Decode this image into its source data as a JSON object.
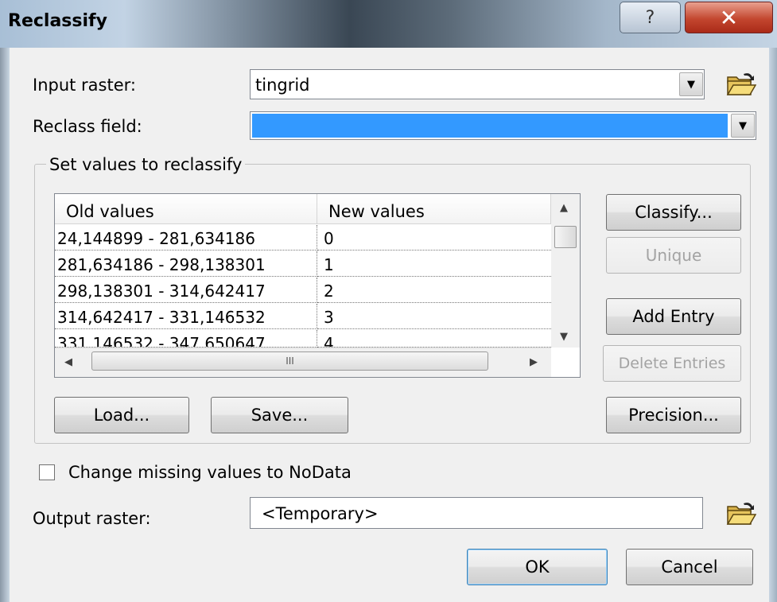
{
  "window": {
    "title": "Reclassify",
    "help_glyph": "?",
    "close_glyph": "✕"
  },
  "input_raster": {
    "label": "Input raster:",
    "value": "tingrid"
  },
  "reclass_field": {
    "label": "Reclass field:",
    "value": ""
  },
  "group": {
    "title": "Set values to reclassify",
    "columns": [
      "Old values",
      "New values"
    ],
    "rows": [
      {
        "old": "24,144899 - 281,634186",
        "new": "0"
      },
      {
        "old": "281,634186 - 298,138301",
        "new": "1"
      },
      {
        "old": "298,138301 - 314,642417",
        "new": "2"
      },
      {
        "old": "314,642417 - 331,146532",
        "new": "3"
      },
      {
        "old": "331,146532 - 347,650647",
        "new": "4"
      }
    ],
    "hscroll_grip": "III",
    "buttons": {
      "classify": "Classify...",
      "unique": "Unique",
      "add_entry": "Add Entry",
      "delete_entries": "Delete Entries",
      "load": "Load...",
      "save": "Save...",
      "precision": "Precision..."
    }
  },
  "nodata": {
    "label": "Change missing values to NoData",
    "checked": false
  },
  "output_raster": {
    "label": "Output raster:",
    "value": "<Temporary>"
  },
  "footer": {
    "ok": "OK",
    "cancel": "Cancel"
  },
  "colors": {
    "selection": "#3399ff",
    "close_red": "#c3472f"
  },
  "icons": {
    "folder": "folder-open-icon",
    "dropdown": "chevron-down-icon"
  }
}
